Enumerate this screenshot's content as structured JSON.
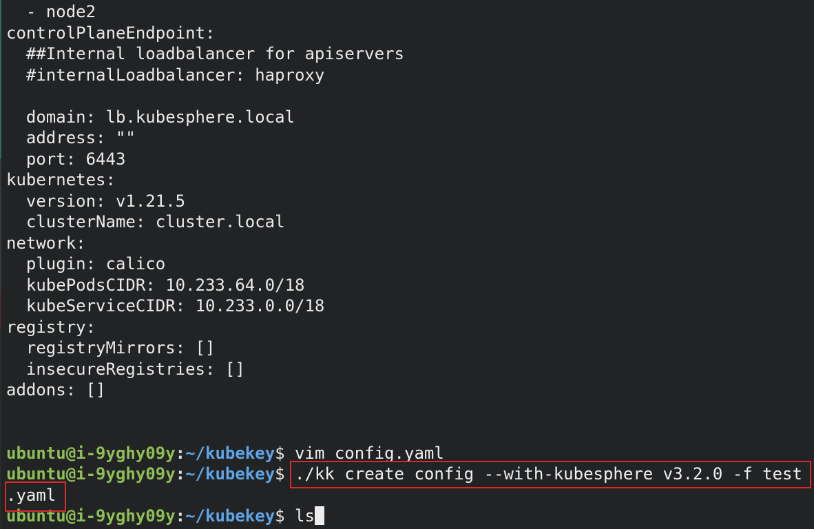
{
  "config_lines": [
    "  - node2",
    "controlPlaneEndpoint:",
    "  ##Internal loadbalancer for apiservers",
    "  #internalLoadbalancer: haproxy",
    "",
    "  domain: lb.kubesphere.local",
    "  address: \"\"",
    "  port: 6443",
    "kubernetes:",
    "  version: v1.21.5",
    "  clusterName: cluster.local",
    "network:",
    "  plugin: calico",
    "  kubePodsCIDR: 10.233.64.0/18",
    "  kubeServiceCIDR: 10.233.0.0/18",
    "registry:",
    "  registryMirrors: []",
    "  insecureRegistries: []",
    "addons: []",
    "",
    ""
  ],
  "prompt": {
    "user_host": "ubuntu@i-9yghy09y",
    "separator": ":",
    "path": "~/kubekey",
    "dollar": "$"
  },
  "commands": {
    "cmd1": "vim config.yaml",
    "cmd2": "./kk create config --with-kubesphere v3.2.0 -f test",
    "cmd2_wrap": ".yaml",
    "cmd3": "ls"
  },
  "colors": {
    "background": "#222325",
    "prompt_user": "#8fbf55",
    "prompt_path": "#5fa6e8",
    "highlight": "#e0272b"
  }
}
